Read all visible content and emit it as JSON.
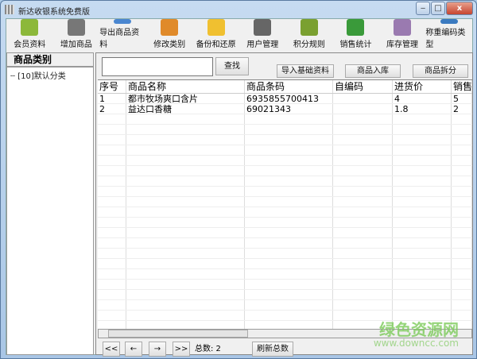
{
  "window": {
    "title": "新达收银系统免费版",
    "minimize": "‒",
    "maximize": "□",
    "close": "x"
  },
  "toolbar": [
    {
      "label": "会员资料",
      "icon": "member-icon",
      "color": "#8cb83a"
    },
    {
      "label": "增加商品",
      "icon": "notepad-pencil-icon",
      "color": "#777"
    },
    {
      "label": "导出商品资料",
      "icon": "export-icon",
      "color": "#4a86d0"
    },
    {
      "label": "修改类别",
      "icon": "puzzle-icon",
      "color": "#e08a2a"
    },
    {
      "label": "备份和还原",
      "icon": "folder-icon",
      "color": "#f0c030"
    },
    {
      "label": "用户管理",
      "icon": "keys-icon",
      "color": "#666"
    },
    {
      "label": "积分规则",
      "icon": "diamond-icon",
      "color": "#7aa030"
    },
    {
      "label": "销售统计",
      "icon": "clipboard-check-icon",
      "color": "#3a9a3a"
    },
    {
      "label": "库存管理",
      "icon": "inventory-icon",
      "color": "#9a7ab0"
    },
    {
      "label": "称重编码类型",
      "icon": "globe-icon",
      "color": "#3a7ac0"
    }
  ],
  "sidebar": {
    "header": "商品类别",
    "tree": [
      "[10]默认分类"
    ]
  },
  "search": {
    "value": "",
    "button": "查找"
  },
  "actions": {
    "import": "导入基础资料",
    "stock_in": "商品入库",
    "split": "商品拆分"
  },
  "table": {
    "columns": [
      "序号",
      "商品名称",
      "商品条码",
      "自编码",
      "进货价",
      "销售"
    ],
    "rows": [
      [
        "1",
        "都市牧场爽口含片",
        "6935855700413",
        "",
        "4",
        "5"
      ],
      [
        "2",
        "益达口香糖",
        "69021343",
        "",
        "1.8",
        "2"
      ]
    ]
  },
  "pager": {
    "first": "<<",
    "prev": "←",
    "next": "→",
    "last": ">>",
    "total_label": "总数: 2",
    "refresh": "刷新总数"
  },
  "watermark": {
    "name": "绿色资源网",
    "url": "www.downcc.com"
  }
}
